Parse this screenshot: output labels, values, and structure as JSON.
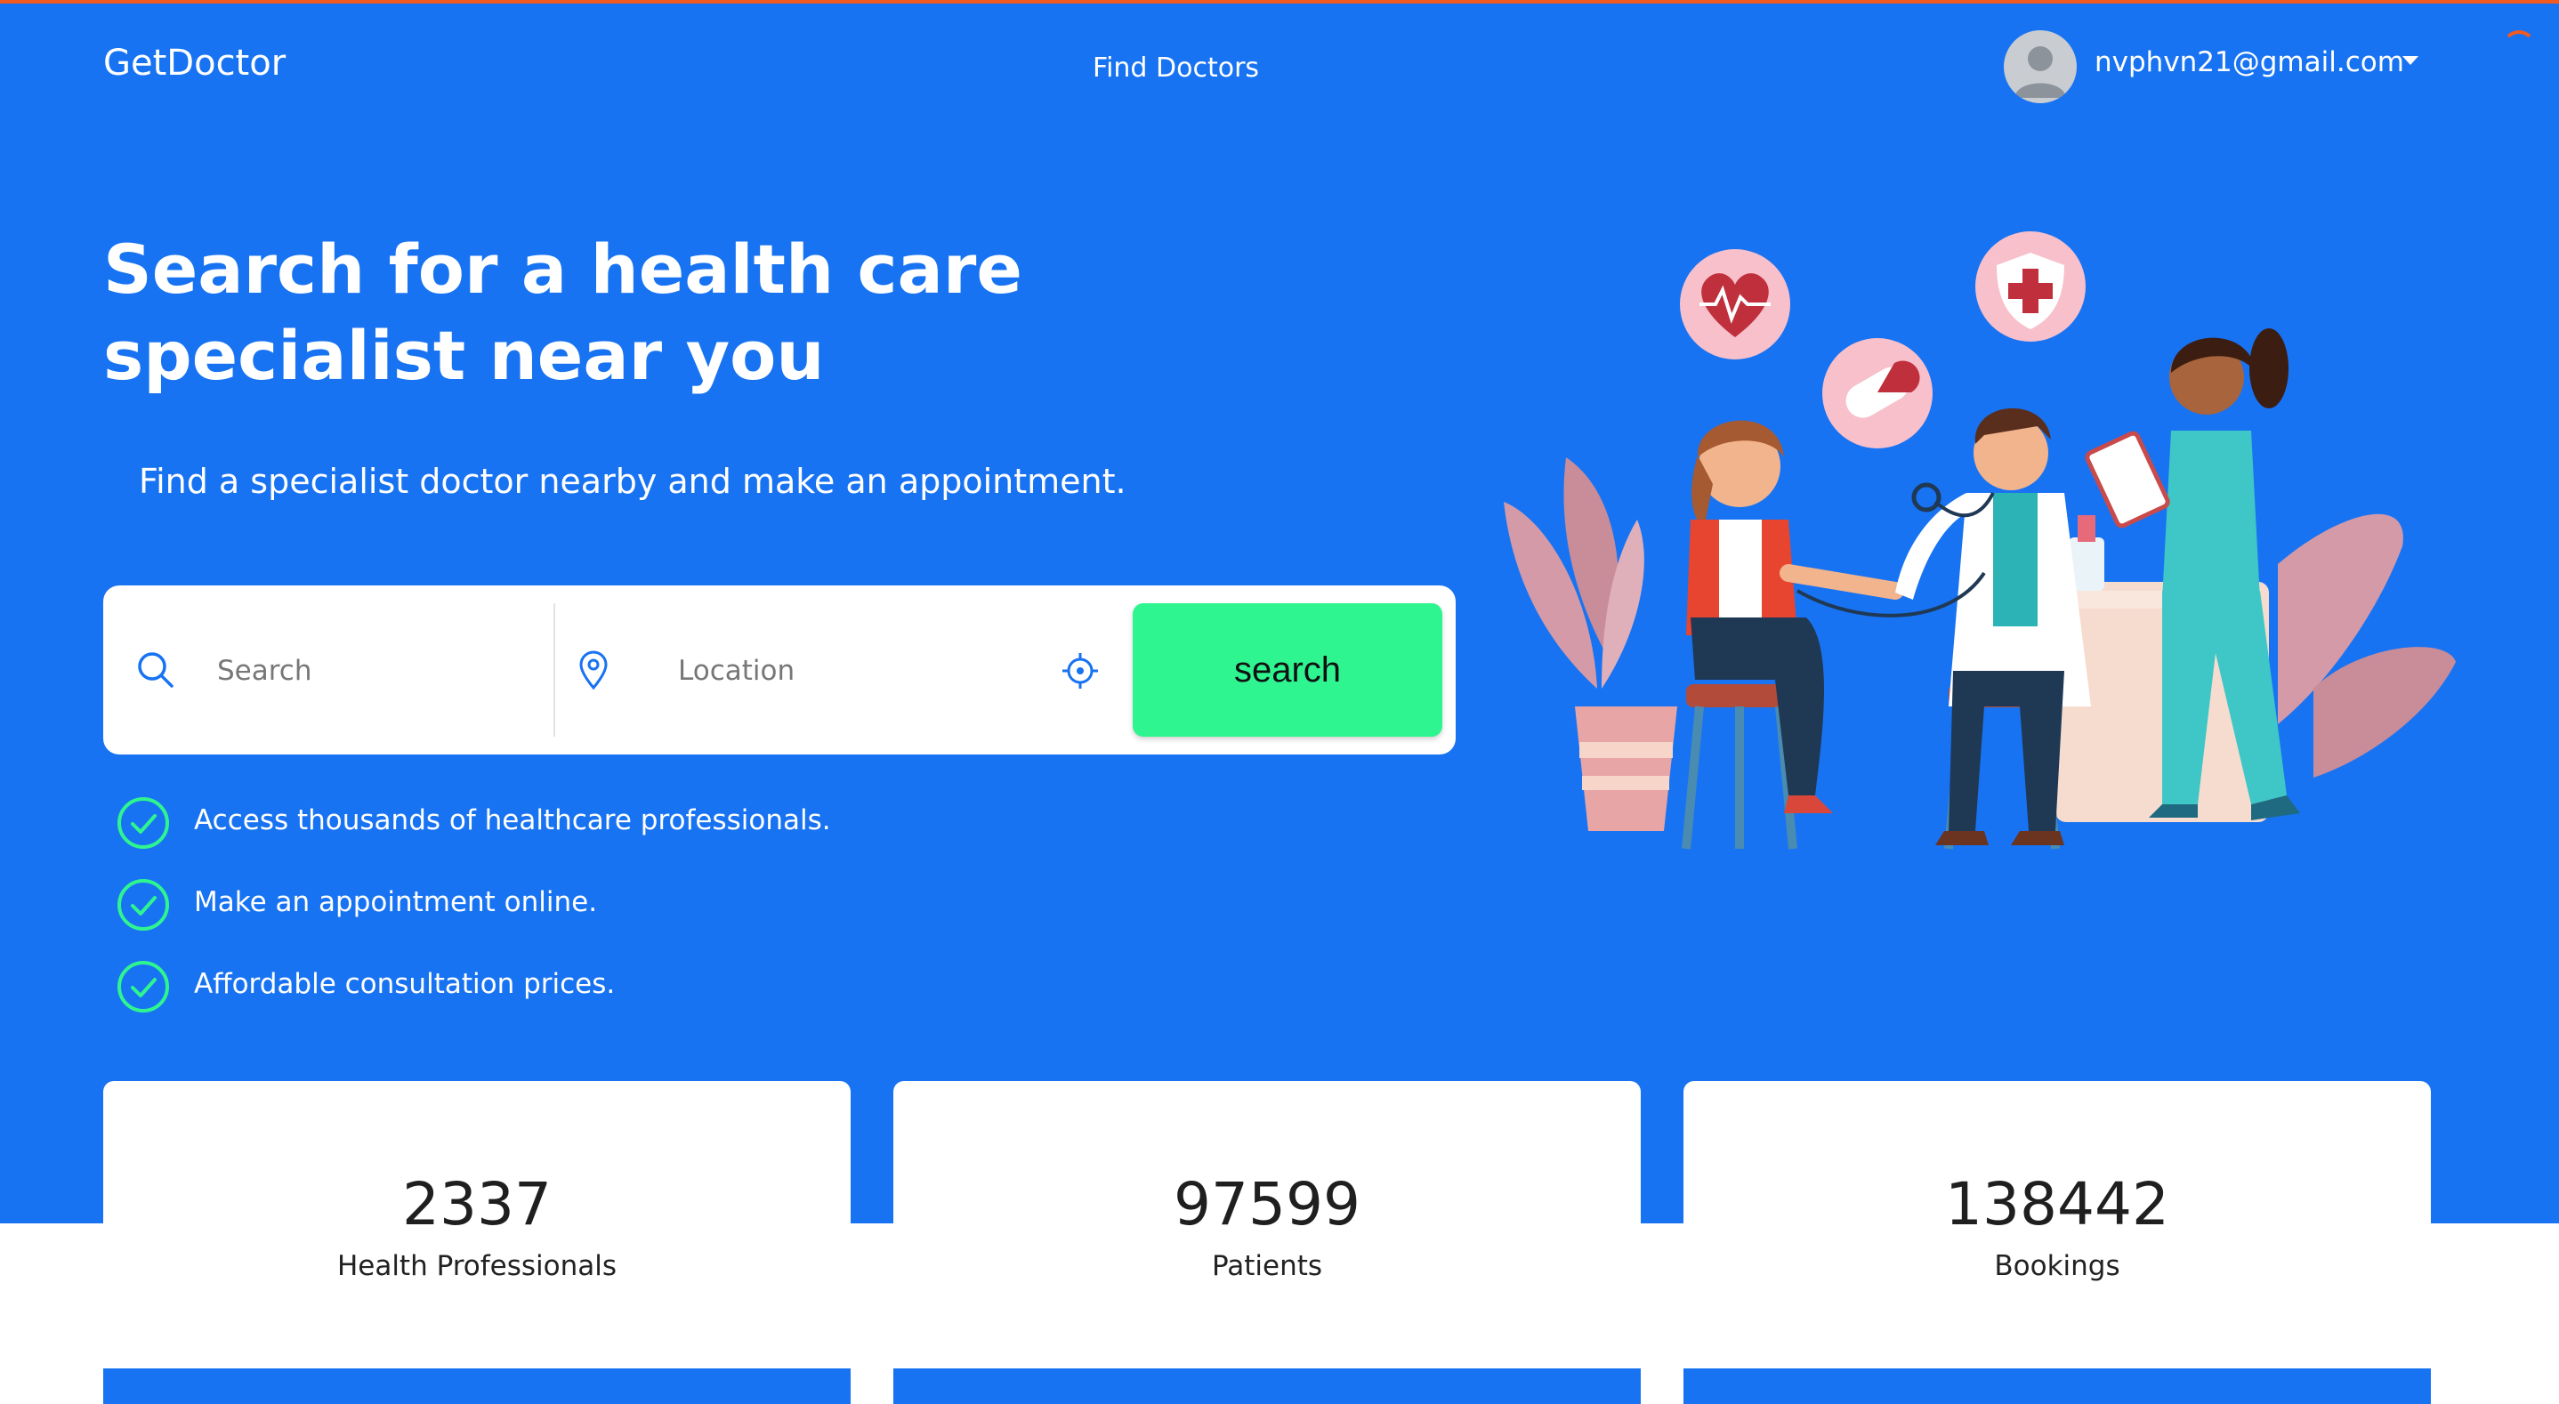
{
  "header": {
    "brand": "GetDoctor",
    "nav_link": "Find Doctors",
    "user_email": "nvphvn21@gmail.com"
  },
  "hero": {
    "headline": "Search for a health care specialist near you",
    "subtitle": "Find a specialist doctor nearby and make an appointment."
  },
  "search": {
    "search_placeholder": "Search",
    "location_placeholder": "Location",
    "button_label": "search"
  },
  "features": [
    "Access thousands of healthcare professionals.",
    "Make an appointment online.",
    "Affordable consultation prices."
  ],
  "stats": [
    {
      "value": "2337",
      "label": "Health Professionals"
    },
    {
      "value": "97599",
      "label": "Patients"
    },
    {
      "value": "138442",
      "label": "Bookings"
    }
  ],
  "colors": {
    "hero_background": "#1873F2",
    "accent_green": "#2EF590",
    "top_border": "#F25A1E"
  },
  "icons": [
    "search-icon",
    "location-pin-icon",
    "crosshair-icon",
    "check-circle-icon",
    "user-avatar-icon",
    "heart-pulse-icon",
    "pill-icon",
    "medical-shield-icon"
  ]
}
